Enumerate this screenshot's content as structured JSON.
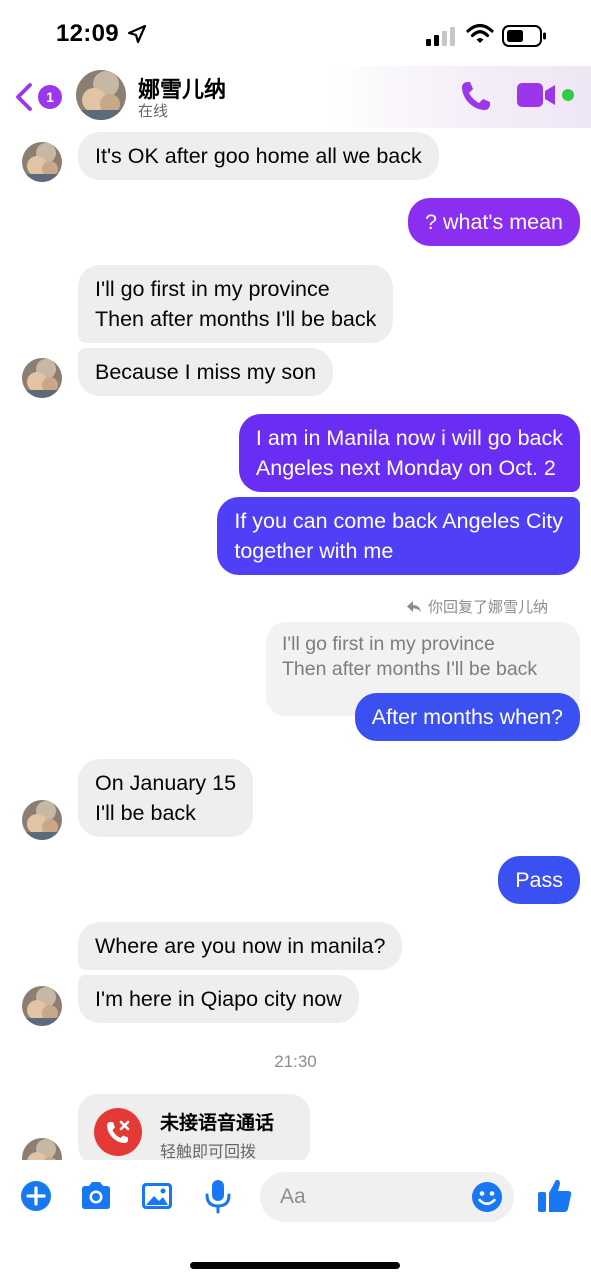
{
  "status_bar": {
    "time": "12:09"
  },
  "header": {
    "back_badge": "1",
    "contact_name": "娜雪儿纳",
    "contact_status": "在线",
    "icons": [
      "back-chevron-icon",
      "phone-icon",
      "video-camera-icon"
    ],
    "accent_color": "#9b36ea"
  },
  "messages": [
    {
      "from": "them",
      "lines": [
        "It's OK after goo home all we back"
      ]
    },
    {
      "from": "me",
      "lines": [
        "?  what's mean"
      ]
    },
    {
      "from": "them",
      "lines": [
        "I'll go first in my province",
        "Then after months I'll be back"
      ]
    },
    {
      "from": "them",
      "lines": [
        "Because I miss my son"
      ]
    },
    {
      "from": "me",
      "lines": [
        "I am in Manila now  i will go back",
        "Angeles next Monday  on Oct. 2"
      ]
    },
    {
      "from": "me",
      "lines": [
        "If you can  come back Angeles City",
        "together with me"
      ]
    },
    {
      "from": "me",
      "lines": [
        "After months  when?"
      ]
    },
    {
      "from": "them",
      "lines": [
        "On January 15",
        "I'll be back"
      ]
    },
    {
      "from": "me",
      "lines": [
        "Pass"
      ]
    },
    {
      "from": "them",
      "lines": [
        "Where are you now in manila?"
      ]
    },
    {
      "from": "them",
      "lines": [
        "I'm here in Qiapo city now"
      ]
    }
  ],
  "reply": {
    "meta": "你回复了娜雪儿纳",
    "quoted_lines": [
      "I'll go first in my province",
      "Then after months I'll be back"
    ]
  },
  "timestamp": "21:30",
  "missed_call": {
    "title": "未接语音通话",
    "subtitle": "轻触即可回拨"
  },
  "composer": {
    "placeholder": "Aa",
    "icons": [
      "plus-icon",
      "camera-icon",
      "image-icon",
      "microphone-icon",
      "emoji-icon",
      "thumbs-up-icon"
    ],
    "accent_color": "#1877f2"
  }
}
